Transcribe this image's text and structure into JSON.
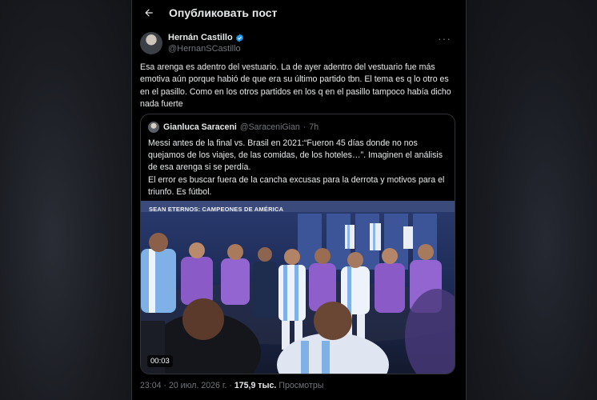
{
  "header": {
    "title": "Опубликовать пост",
    "back_icon": "arrow-left-icon"
  },
  "post": {
    "author_name": "Hernán Castillo",
    "author_handle": "@HernanSCastillo",
    "verified_icon": "verified-badge-icon",
    "more_icon": "more-options-icon",
    "text": "Esa arenga es adentro del vestuario. La de ayer adentro del vestuario fue más emotiva aún porque habió de que era su último partido tbn. El tema es q lo otro es en el pasillo. Como en los otros partidos en los q en el pasillo tampoco había dicho nada fuerte",
    "time": "23:04",
    "date": "20 июл. 2026 г.",
    "views_count": "175,9 тыс.",
    "views_label": "Просмотры",
    "separator": "·"
  },
  "quote": {
    "author_name": "Gianluca Saraceni",
    "author_handle": "@SaraceniGian",
    "age": "7h",
    "separator": "·",
    "text_p1": "Messi antes de la final vs. Brasil en 2021:“Fueron 45 días donde no nos quejamos de los viajes, de las comidas, de los hoteles…”. Imaginen el análisis de esa arenga si se perdía.",
    "text_p2": "El error es buscar fuera de la cancha excusas para la derrota y motivos para el triunfo. Es fútbol.",
    "video": {
      "caption": "SEAN ETERNOS: CAMPEONES DE AMÉRICA",
      "duration": "00:03"
    }
  },
  "colors": {
    "background": "#000000",
    "text": "#e7e9ea",
    "muted": "#71767b",
    "border": "#2f3336",
    "verified": "#1d9bf0"
  }
}
